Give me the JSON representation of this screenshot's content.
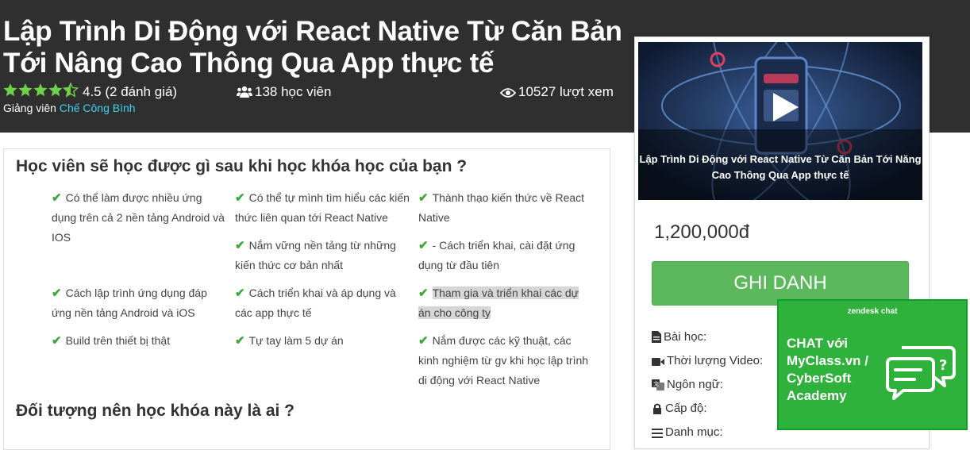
{
  "course": {
    "title_line1": "Lập Trình Di Động với React Native Từ Căn Bản",
    "title_line2": "Tới Nâng Cao Thông Qua App thực tế",
    "rating": 4.5,
    "rating_text": "4.5 (2 đánh giá)",
    "students": "138 học viên",
    "views": "10527 lượt xem",
    "instructor_label": "Giảng viên",
    "instructor_name": "Chế Công Bình"
  },
  "learn": {
    "heading": "Học viên sẽ học được gì sau khi học khóa học của bạn ?",
    "items": [
      [
        "Có thể làm được nhiều ứng",
        "dụng trên cả 2 nền tảng Android và",
        "IOS"
      ],
      [
        "Có thể tự mình tìm hiểu các kiến",
        "thức liên quan tới React Native"
      ],
      [
        "Thành thạo kiến thức về React",
        "Native"
      ],
      [
        "Nắm vững nền tảng từ những",
        "kiến thức cơ bản nhất"
      ],
      [
        "- Cách triển khai, cài đặt ứng",
        "dụng từ đầu tiên"
      ],
      [
        "Cách lập trình ứng dụng đáp",
        "ứng nền tảng Android và iOS"
      ],
      [
        "Cách triển khai và áp dụng và",
        "các app thực tế"
      ],
      [
        "Tham gia và triển khai các dự",
        "án cho công ty"
      ],
      [
        "Build trên thiết bị thật"
      ],
      [
        "Tự tay làm 5 dự án"
      ],
      [
        "Nắm được các kỹ thuật, các",
        "kinh nghiệm từ gv khi học lập trình",
        "di động với React Native"
      ]
    ],
    "audience_heading": "Đối tượng nên học khóa này là ai ?"
  },
  "sidebar": {
    "video_caption_line1": "Lập Trình Di Động với React Native Từ Căn Bản Tới Năng",
    "video_caption_line2": "Cao Thông Qua App thực tế",
    "price": "1,200,000đ",
    "enroll_label": "GHI DANH",
    "info": {
      "lessons": "Bài học:",
      "duration": "Thời lượng Video:",
      "language": "Ngôn ngữ:",
      "level": "Cấp độ:",
      "category": "Danh mục:"
    }
  },
  "chat": {
    "brand": "zendesk chat",
    "line1": "CHAT với",
    "line2": "MyClass.vn /",
    "line3": "CyberSoft",
    "line4": "Academy"
  },
  "colors": {
    "header_bg": "#2f2f2f",
    "star": "#6fd14a",
    "link": "#3fd0f0",
    "check": "#3aa83a",
    "enroll": "#5cb85c",
    "chat": "#2fb23b"
  }
}
